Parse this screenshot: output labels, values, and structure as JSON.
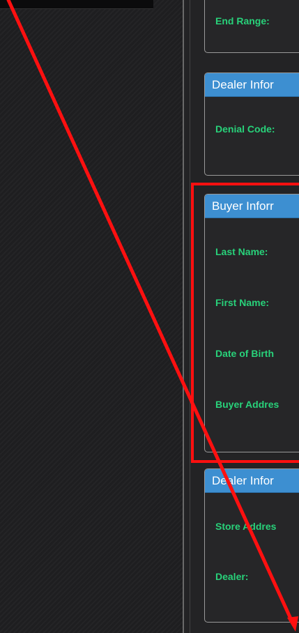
{
  "panels": {
    "range": {
      "end_range_label": "End Range:"
    },
    "dealer_denial": {
      "header": "Dealer Infor",
      "denial_code_label": "Denial Code:"
    },
    "buyer": {
      "header": "Buyer Inforr",
      "last_name_label": "Last Name:",
      "first_name_label": "First Name:",
      "dob_label": "Date of Birth",
      "address_label": "Buyer Addres"
    },
    "dealer_store": {
      "header": "Dealer Infor",
      "store_address_label": "Store Addres",
      "dealer_label": "Dealer:"
    }
  },
  "colors": {
    "header_blue": "#3d8fd1",
    "label_green": "#28d27a",
    "highlight_red": "#ff1010"
  }
}
